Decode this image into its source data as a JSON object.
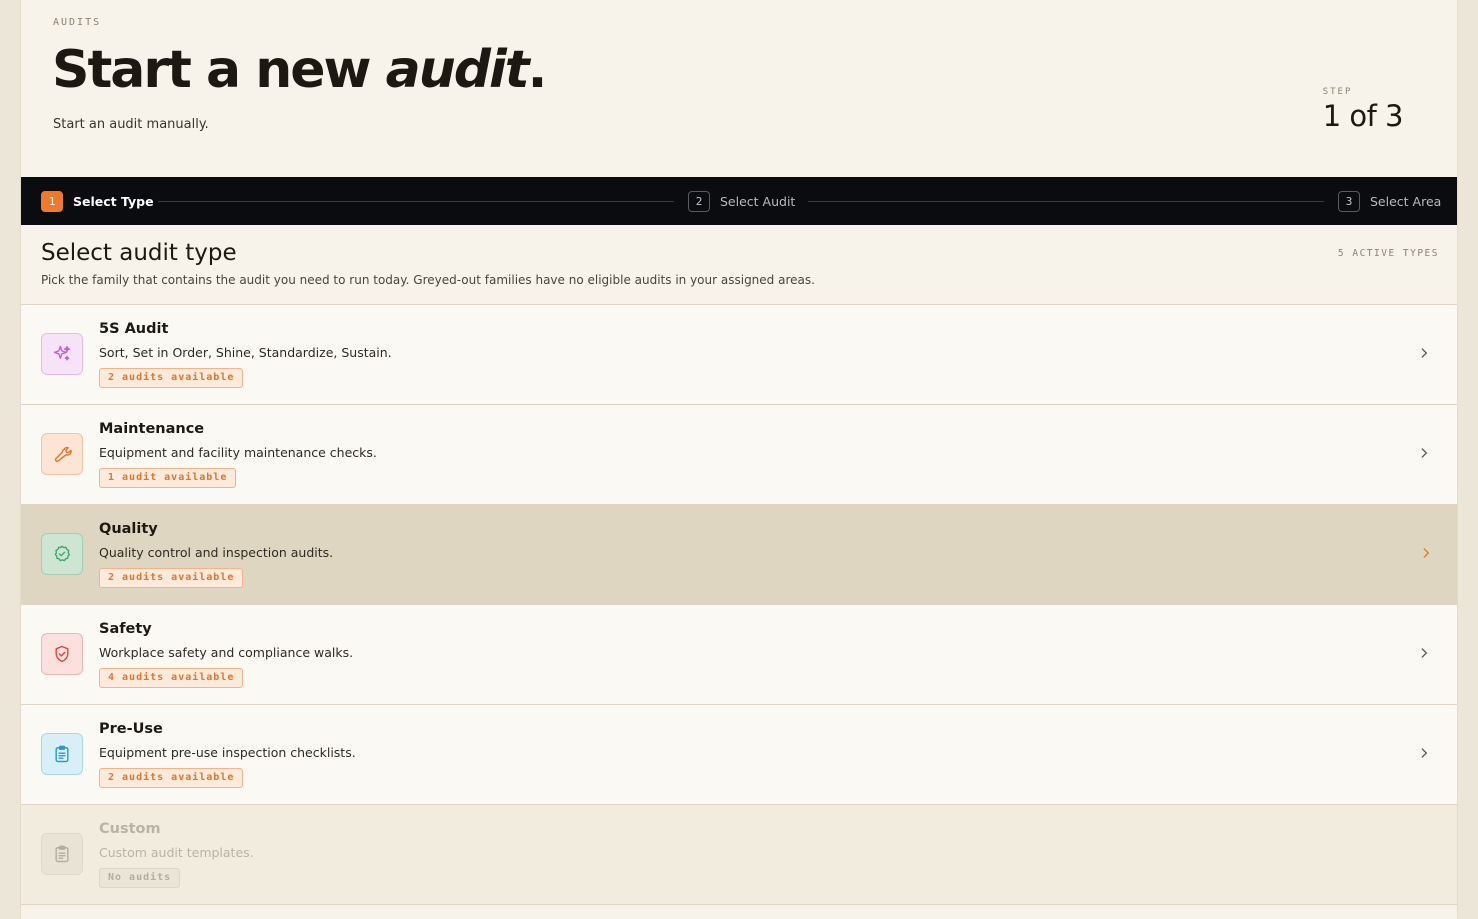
{
  "header": {
    "eyebrow": "AUDITS",
    "title_main": "Start a new ",
    "title_em": "audit",
    "title_end": ".",
    "subtitle": "Start an audit manually.",
    "step_label": "STEP",
    "step_value": "1 of 3"
  },
  "stepper": {
    "steps": [
      {
        "num": "1",
        "label": "Select Type",
        "active": true
      },
      {
        "num": "2",
        "label": "Select Audit",
        "active": false
      },
      {
        "num": "3",
        "label": "Select Area",
        "active": false
      }
    ]
  },
  "section": {
    "title": "Select audit type",
    "description": "Pick the family that contains the audit you need to run today. Greyed-out families have no eligible audits in your assigned areas.",
    "count": "5 ACTIVE TYPES"
  },
  "types": [
    {
      "name": "5S Audit",
      "desc": "Sort, Set in Order, Shine, Standardize, Sustain.",
      "badge": "2 audits available",
      "icon": "sparkles-icon",
      "color": "#c25bd6"
    },
    {
      "name": "Maintenance",
      "desc": "Equipment and facility maintenance checks.",
      "badge": "1 audit available",
      "icon": "wrench-icon",
      "color": "#e2742e"
    },
    {
      "name": "Quality",
      "desc": "Quality control and inspection audits.",
      "badge": "2 audits available",
      "icon": "badge-check-icon",
      "color": "#3aa66a"
    },
    {
      "name": "Safety",
      "desc": "Workplace safety and compliance walks.",
      "badge": "4 audits available",
      "icon": "shield-check-icon",
      "color": "#e0483e"
    },
    {
      "name": "Pre-Use",
      "desc": "Equipment pre-use inspection checklists.",
      "badge": "2 audits available",
      "icon": "clipboard-icon",
      "color": "#2b9ad0"
    },
    {
      "name": "Custom",
      "desc": "Custom audit templates.",
      "badge": "No audits",
      "icon": "clipboard-icon",
      "color": "#b4ad9f"
    }
  ],
  "colors": {
    "accent": "#f07a2c",
    "stepper_bg": "#0b0c10",
    "page_bg": "#f7f3ea",
    "hover_row": "#ded6c1"
  }
}
